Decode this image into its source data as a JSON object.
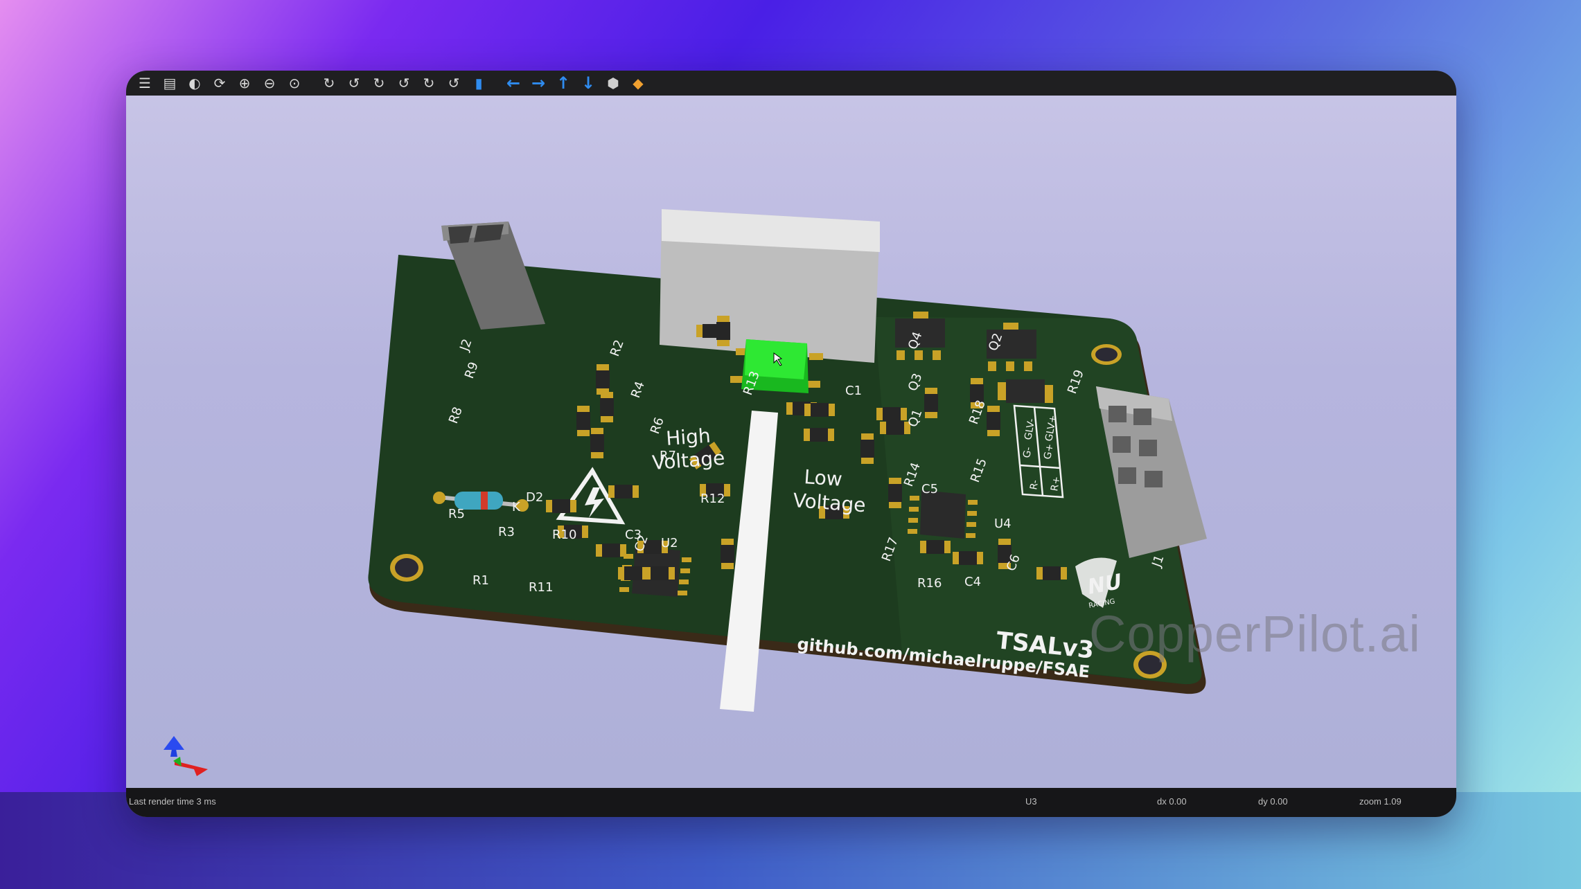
{
  "toolbar": {
    "icons": [
      "render-options-icon",
      "copy-image-icon",
      "raytrace-icon",
      "reload-icon",
      "zoom-in-icon",
      "zoom-out-icon",
      "zoom-fit-icon",
      "rotate-x-icon",
      "rotate-x-ccw-icon",
      "rotate-y-icon",
      "rotate-y-ccw-icon",
      "rotate-z-icon",
      "rotate-z-ccw-icon",
      "flip-board-icon",
      "move-left-icon",
      "move-right-icon",
      "move-up-icon",
      "move-down-icon",
      "perspective-icon",
      "layers-icon"
    ]
  },
  "board": {
    "labels": {
      "high_voltage_1": "High",
      "high_voltage_2": "Voltage",
      "low_voltage_1": "Low",
      "low_voltage_2": "Voltage",
      "title": "TSALv3",
      "url": "github.com/michaelruppe/FSAE",
      "logo_text": "NU",
      "logo_sub": "RACING"
    },
    "refs": [
      "J2",
      "R2",
      "R9",
      "R4",
      "R8",
      "R6",
      "R7",
      "D2",
      "K",
      "R5",
      "R3",
      "R10",
      "C2",
      "R1",
      "R11",
      "C3",
      "U2",
      "R12",
      "R13",
      "C1",
      "Q4",
      "Q3",
      "Q2",
      "R18",
      "Q1",
      "R19",
      "R14",
      "C5",
      "R15",
      "U4",
      "R17",
      "R16",
      "C4",
      "C6",
      "J1"
    ],
    "pin_labels": [
      "GLV-",
      "GLV+",
      "G-",
      "G+",
      "R-",
      "R+"
    ]
  },
  "watermark": "CopperPilot.ai",
  "status": {
    "render_time": "Last render time 3 ms",
    "selected": "U3",
    "dx": "dx 0.00",
    "dy": "dy 0.00",
    "zoom": "zoom 1.09"
  },
  "colors": {
    "pcb": "#1c3b1f",
    "pad": "#c9a227",
    "highlight": "#22e02a",
    "silkscreen": "#f2f2f2"
  }
}
